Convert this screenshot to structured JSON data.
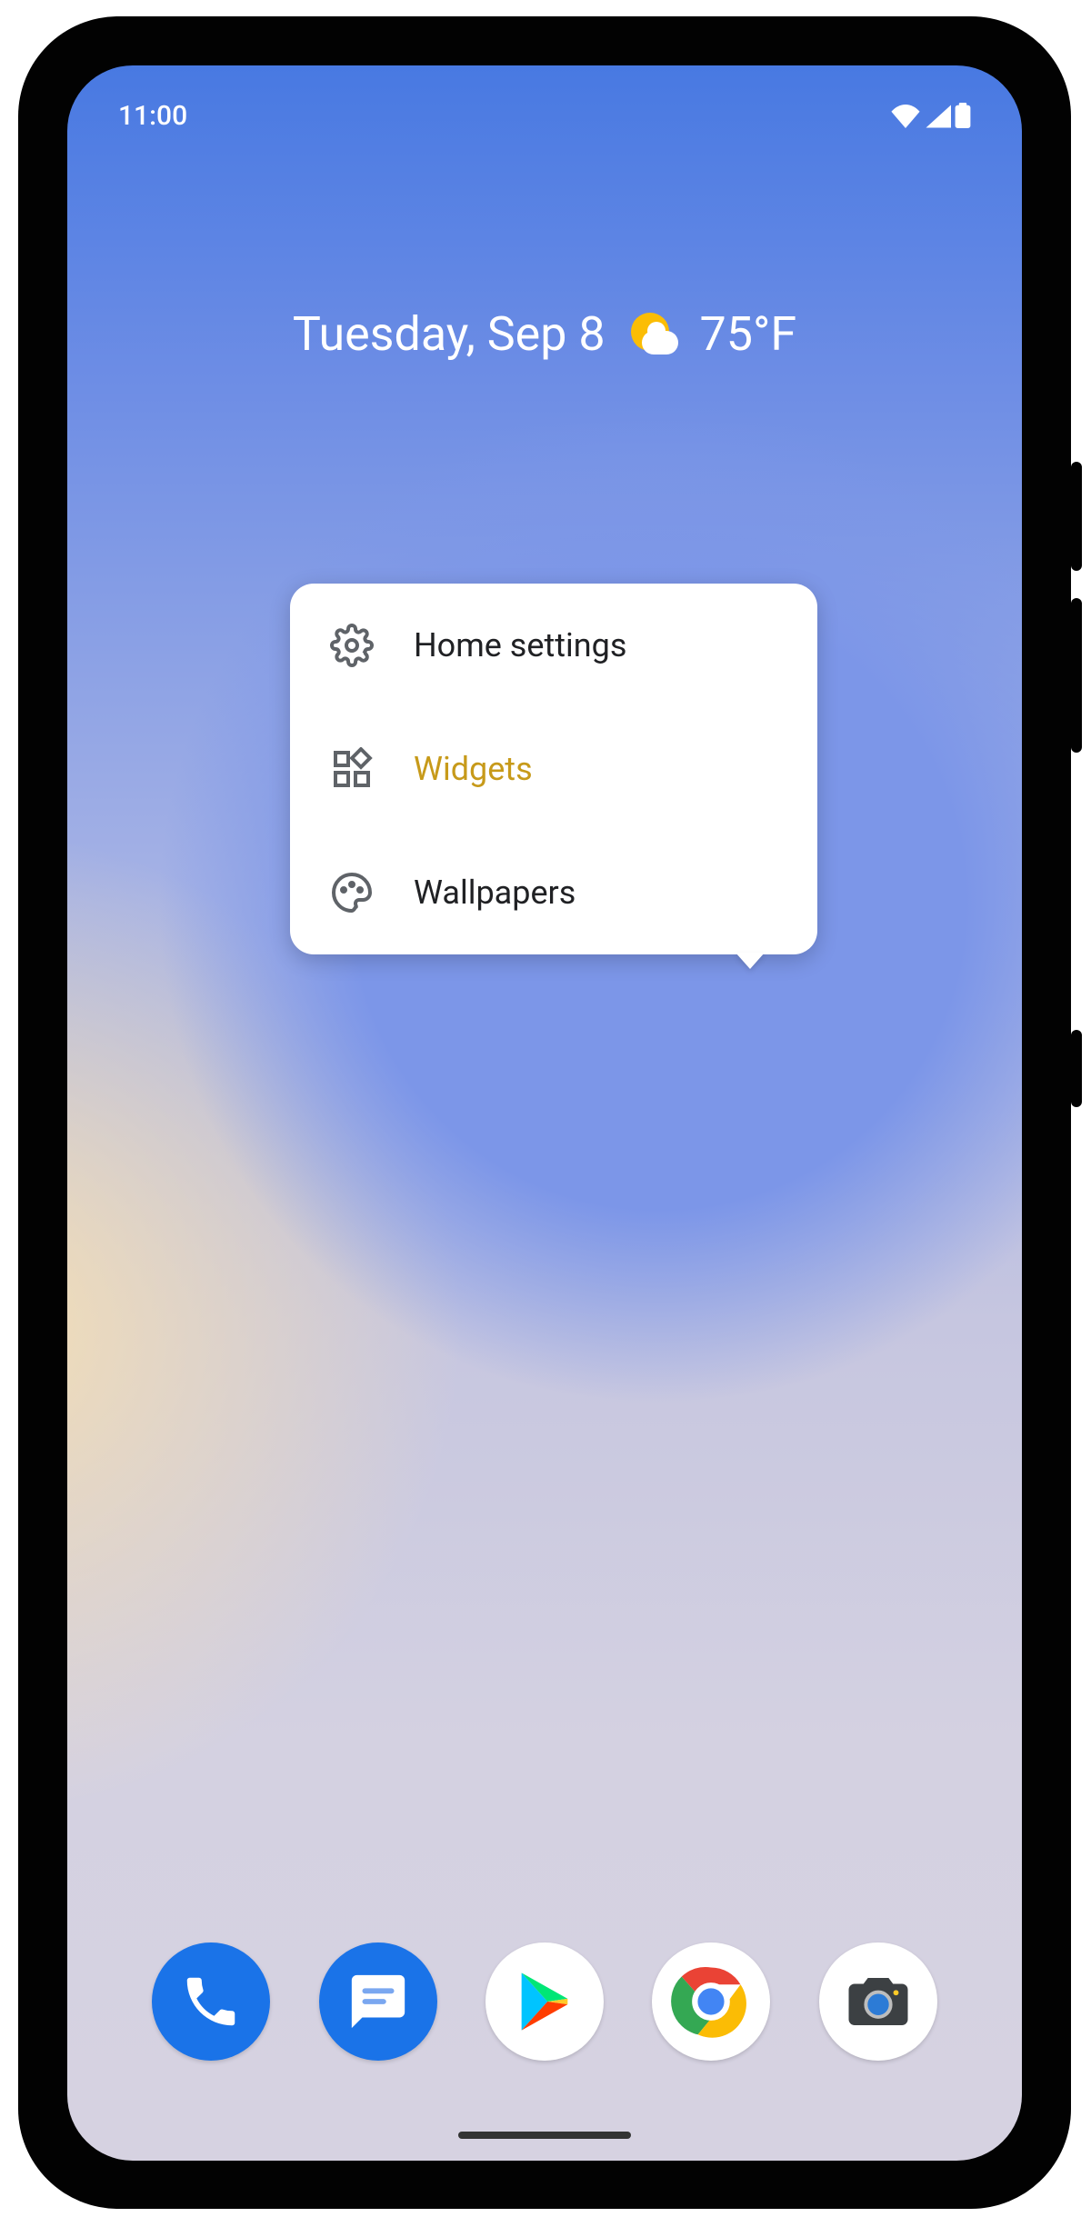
{
  "statusbar": {
    "time": "11:00"
  },
  "widget": {
    "date_label": "Tuesday, Sep 8",
    "temp_label": "75°F"
  },
  "menu": {
    "items": [
      {
        "id": "home-settings",
        "label": "Home settings"
      },
      {
        "id": "widgets",
        "label": "Widgets"
      },
      {
        "id": "wallpapers",
        "label": "Wallpapers"
      }
    ],
    "highlighted": "widgets"
  },
  "dock": {
    "apps": [
      {
        "id": "phone",
        "label": "Phone"
      },
      {
        "id": "messages",
        "label": "Messages"
      },
      {
        "id": "play",
        "label": "Play Store"
      },
      {
        "id": "chrome",
        "label": "Chrome"
      },
      {
        "id": "camera",
        "label": "Camera"
      }
    ]
  },
  "colors": {
    "tap_highlight": "#f9c228",
    "dock_blue": "#1a73e8"
  }
}
